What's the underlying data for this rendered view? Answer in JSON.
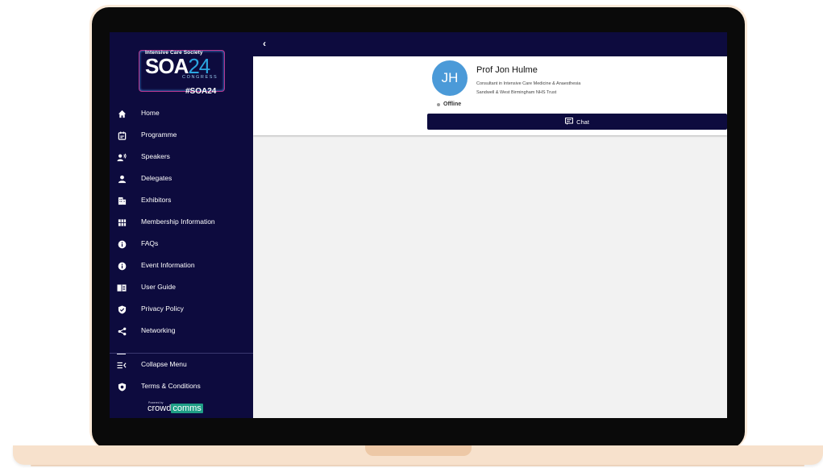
{
  "logo": {
    "org": "Intensive Care Society",
    "title_letters": "SOA",
    "title_number": "24",
    "subtitle": "CONGRESS",
    "hashtag": "#SOA24"
  },
  "nav": {
    "items": [
      {
        "label": "Home",
        "icon": "home-icon"
      },
      {
        "label": "Programme",
        "icon": "calendar-icon"
      },
      {
        "label": "Speakers",
        "icon": "speaker-icon"
      },
      {
        "label": "Delegates",
        "icon": "person-icon"
      },
      {
        "label": "Exhibitors",
        "icon": "building-icon"
      },
      {
        "label": "Membership Information",
        "icon": "grid-icon"
      },
      {
        "label": "FAQs",
        "icon": "info-icon"
      },
      {
        "label": "Event Information",
        "icon": "info-icon"
      },
      {
        "label": "User Guide",
        "icon": "book-icon"
      },
      {
        "label": "Privacy Policy",
        "icon": "shield-icon"
      },
      {
        "label": "Networking",
        "icon": "share-icon"
      }
    ],
    "collapse_label": "Collapse Menu",
    "terms_label": "Terms & Conditions"
  },
  "footer": {
    "powered_by": "Powered by",
    "brand_left": "crowd",
    "brand_right": "comms"
  },
  "profile": {
    "initials": "JH",
    "name": "Prof Jon Hulme",
    "role_line1": "Consultant in Intensive Care Medicine & Anaesthesia",
    "role_line2": "Sandwell & West Birmingham NHS Trust",
    "status": "Offline",
    "chat_label": "Chat"
  },
  "colors": {
    "navy": "#0d0b3e",
    "avatar_blue": "#4b9ad8",
    "frame_peach": "#fbead9"
  }
}
